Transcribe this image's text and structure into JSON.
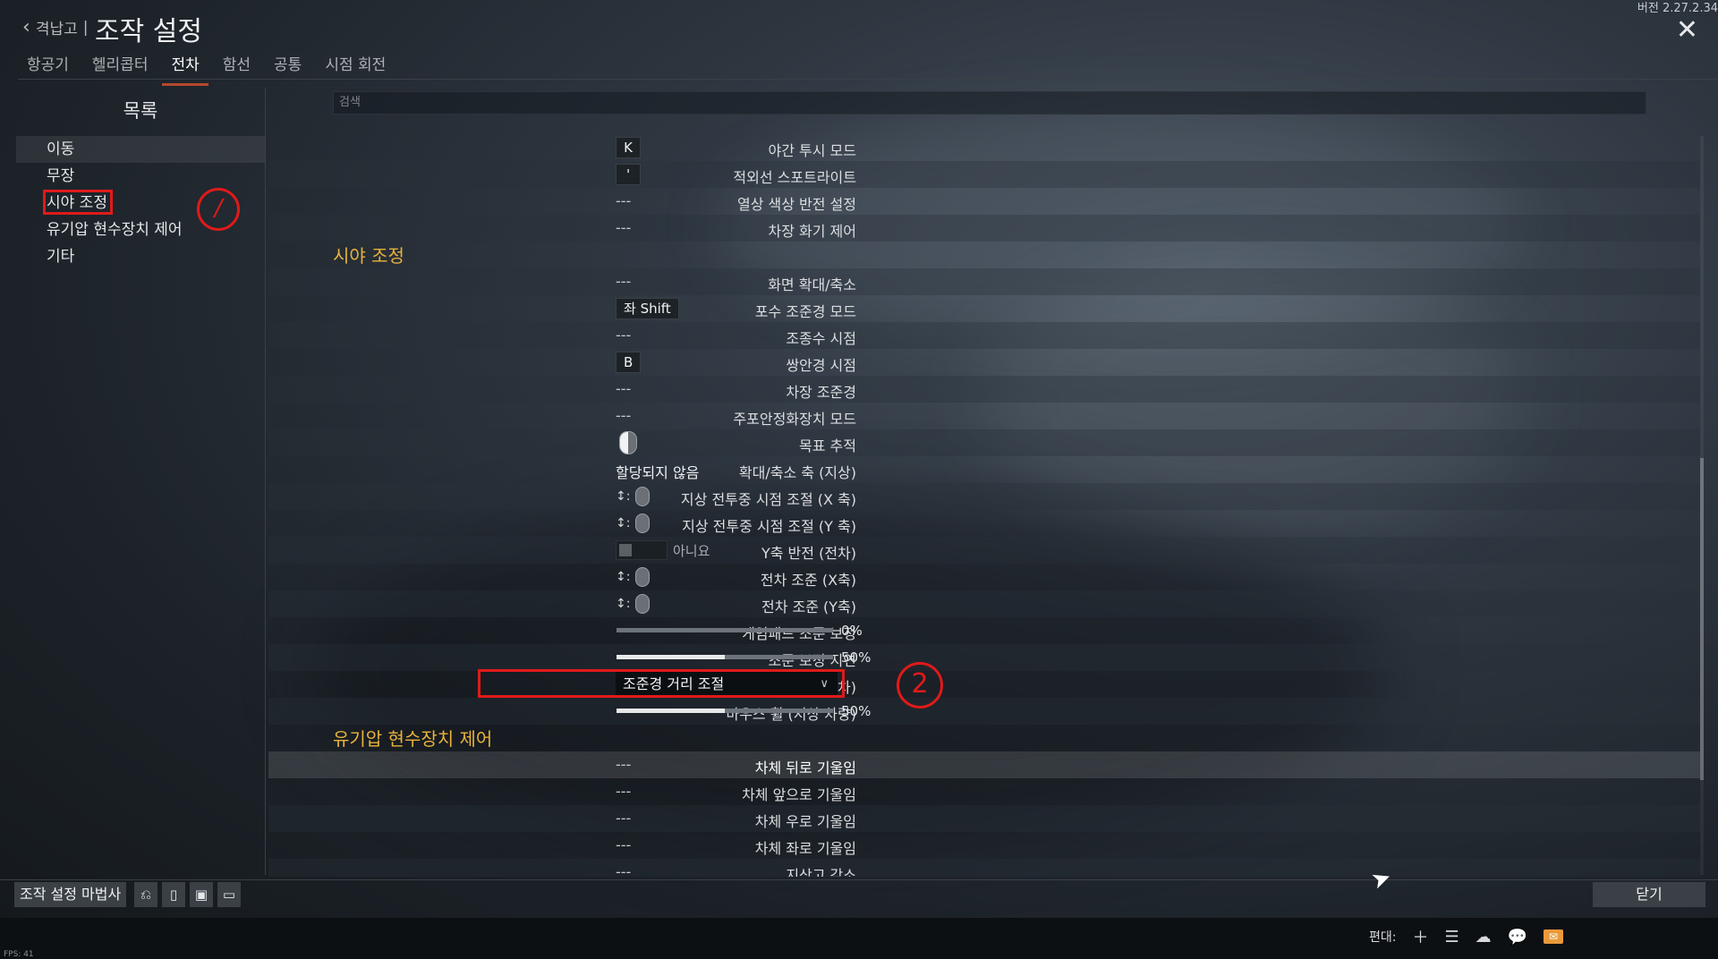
{
  "header": {
    "back_label": "격납고",
    "title": "조작 설정",
    "version": "버전 2.27.2.34",
    "close_icon": "✕"
  },
  "tabs": [
    "항공기",
    "헬리콥터",
    "전차",
    "함선",
    "공통",
    "시점 회전"
  ],
  "active_tab": "전차",
  "sidebar": {
    "heading": "목록",
    "items": [
      "이동",
      "무장",
      "시야 조정",
      "유기압 현수장치 제어",
      "기타"
    ]
  },
  "annotations": {
    "mark1": "/",
    "mark2": "2"
  },
  "search": {
    "placeholder": "검색"
  },
  "rows": {
    "r1": {
      "label": "야간 투시 모드",
      "key": "K"
    },
    "r2": {
      "label": "적외선 스포트라이트",
      "key": "'"
    },
    "r3": {
      "label": "열상 색상 반전 설정",
      "value": "---"
    },
    "r4": {
      "label": "차장 화기 제어",
      "value": "---"
    },
    "section1": "시야 조정",
    "r5": {
      "label": "화면 확대/축소",
      "value": "---"
    },
    "r6": {
      "label": "포수 조준경 모드",
      "key": "좌 Shift"
    },
    "r7": {
      "label": "조종수 시점",
      "value": "---"
    },
    "r8": {
      "label": "쌍안경 시점",
      "key": "B"
    },
    "r9": {
      "label": "차장 조준경",
      "value": "---"
    },
    "r10": {
      "label": "주포안정화장치 모드",
      "value": "---"
    },
    "r11": {
      "label": "목표 추적",
      "icon": "mouse-left-button-icon"
    },
    "r12": {
      "label": "확대/축소 축 (지상)",
      "value": "할당되지 않음"
    },
    "r13": {
      "label": "지상 전투중 시점 조절 (X 축)",
      "axis": "↕:"
    },
    "r14": {
      "label": "지상 전투중 시점 조절 (Y 축)",
      "axis": "↕:"
    },
    "r15": {
      "label": "Y축 반전 (전차)",
      "toggle_label": "아니요",
      "toggle_on": false
    },
    "r16": {
      "label": "전차 조준 (X축)",
      "axis": "↕:"
    },
    "r17": {
      "label": "전차 조준 (Y축)",
      "axis": "↕:"
    },
    "r18": {
      "label": "게임패드 조준 보정",
      "percent_text": "0%",
      "percent": 0
    },
    "r19": {
      "label": "조준 보정 지연",
      "percent_text": "50%",
      "percent": 50
    },
    "r20": {
      "label": "마우스 휠 (전차)",
      "dropdown": "조준경 거리 조절"
    },
    "r21": {
      "label": "마우스 휠 (지상 차량)",
      "percent_text": "50%",
      "percent": 50
    },
    "section2": "유기압 현수장치 제어",
    "r22": {
      "label": "차체 뒤로 기울임",
      "value": "---"
    },
    "r23": {
      "label": "차체 앞으로 기울임",
      "value": "---"
    },
    "r24": {
      "label": "차체 우로 기울임",
      "value": "---"
    },
    "r25": {
      "label": "차체 좌로 기울임",
      "value": "---"
    },
    "r26": {
      "label": "지상고 감소",
      "value": "---"
    }
  },
  "bottom": {
    "wizard_label": "조작 설정 마법사",
    "close_label": "닫기"
  },
  "status": {
    "squad_label": "편대:",
    "fps": "FPS: 41"
  },
  "colors": {
    "accent_tab": "#b5482e",
    "section_header": "#e8b23c",
    "annotation_red": "#e01a1a"
  }
}
